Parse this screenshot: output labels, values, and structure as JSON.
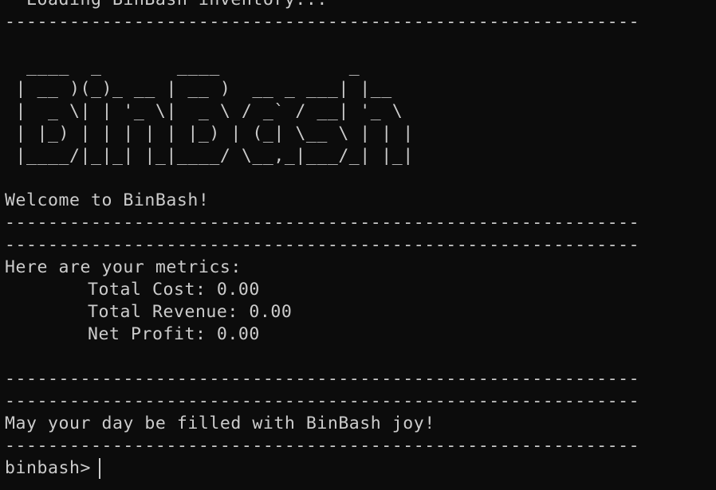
{
  "terminal": {
    "clipped_top_text": "  Loading BinBash inventory...",
    "divider": "-----------------------------------------------------------------------------------------------",
    "ascii_logo": [
      "  ____  _       ____            _",
      " | __ )(_)_ __ | __ )  __ _ ___| |__",
      " |  _ \\| | '_ \\|  _ \\ / _` / __| '_ \\",
      " | |_) | | | | | |_) | (_| \\__ \\ | | |",
      " |____/|_|_| |_|____/ \\__,_|___/_| |_|"
    ],
    "welcome": "Welcome to BinBash!",
    "metrics_header": "Here are your metrics:",
    "metrics": [
      "Total Cost: 0.00",
      "Total Revenue: 0.00",
      "Net Profit: 0.00"
    ],
    "farewell": "May your day be filled with BinBash joy!",
    "prompt": "binbash>"
  }
}
